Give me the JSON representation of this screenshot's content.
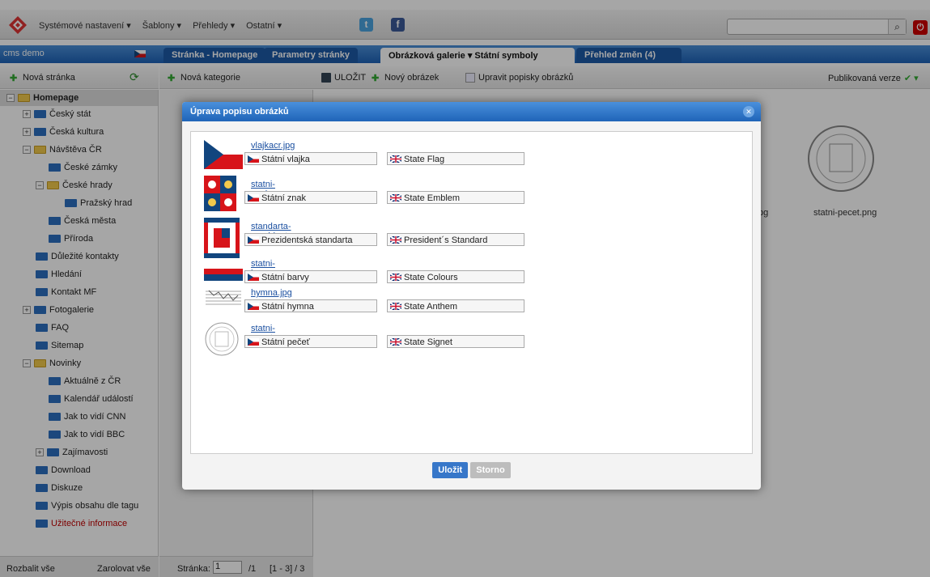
{
  "menu": {
    "items": [
      "Systémové nastavení ▾",
      "Šablony ▾",
      "Přehledy ▾",
      "Ostatní ▾"
    ]
  },
  "site": {
    "name": "cms demo"
  },
  "tabs": [
    {
      "label": "Stránka - Homepage"
    },
    {
      "label": "Parametry stránky"
    },
    {
      "label": "Obrázková galerie ▾  Státní symboly"
    },
    {
      "label": "Přehled změn (4)"
    }
  ],
  "toolbar": {
    "new_page": "Nová stránka",
    "new_category": "Nová kategorie",
    "save": "ULOŽIT",
    "new_image": "Nový obrázek",
    "edit_descriptions": "Upravit popisky obrázků",
    "published_version": "Publikovaná verze"
  },
  "tree": [
    {
      "label": "Homepage",
      "bold": true
    },
    {
      "label": "Český stát"
    },
    {
      "label": "Česká kultura"
    },
    {
      "label": "Návštěva ČR"
    },
    {
      "label": "České zámky"
    },
    {
      "label": "České hrady"
    },
    {
      "label": "Pražský hrad"
    },
    {
      "label": "Česká města"
    },
    {
      "label": "Příroda"
    },
    {
      "label": "Důležité kontakty"
    },
    {
      "label": "Hledání"
    },
    {
      "label": "Kontakt MF"
    },
    {
      "label": "Fotogalerie"
    },
    {
      "label": "FAQ"
    },
    {
      "label": "Sitemap"
    },
    {
      "label": "Novinky"
    },
    {
      "label": "Aktuálně z ČR"
    },
    {
      "label": "Kalendář událostí"
    },
    {
      "label": "Jak to vidí CNN"
    },
    {
      "label": "Jak to vidí BBC"
    },
    {
      "label": "Zajímavosti"
    },
    {
      "label": "Download"
    },
    {
      "label": "Diskuze"
    },
    {
      "label": "Výpis obsahu dle tagu"
    },
    {
      "label": "Užitečné informace"
    }
  ],
  "footer": {
    "expand_all": "Rozbalit vše",
    "collapse_all": "Zarolovat vše",
    "page_label": "Stránka:",
    "page_value": "1",
    "page_total": "/1",
    "range": "[1 - 3] / 3"
  },
  "gallery_right": {
    "filename": "statni-pecet.png",
    "partial": "pg"
  },
  "modal": {
    "title": "Úprava popisu obrázků",
    "save": "Uložit",
    "cancel": "Storno",
    "items": [
      {
        "file": "vlajkacr.jpg",
        "cs": "Státní vlajka",
        "en": "State Flag"
      },
      {
        "file": "statni-znak.png",
        "cs": "Státní znak",
        "en": "State Emblem"
      },
      {
        "file": "standarta-prezidenta.png",
        "cs": "Prezidentská standarta",
        "en": "President´s Standard"
      },
      {
        "file": "statni-barvy.png",
        "cs": "Státní barvy",
        "en": "State Colours"
      },
      {
        "file": "hymna.jpg",
        "cs": "Státní hymna",
        "en": "State Anthem"
      },
      {
        "file": "statni-pecet.png",
        "cs": "Státní pečeť",
        "en": "State Signet"
      }
    ]
  },
  "colors": {
    "accent": "#1f64b8",
    "link": "#1a4fa0",
    "red_text": "#c00000"
  }
}
